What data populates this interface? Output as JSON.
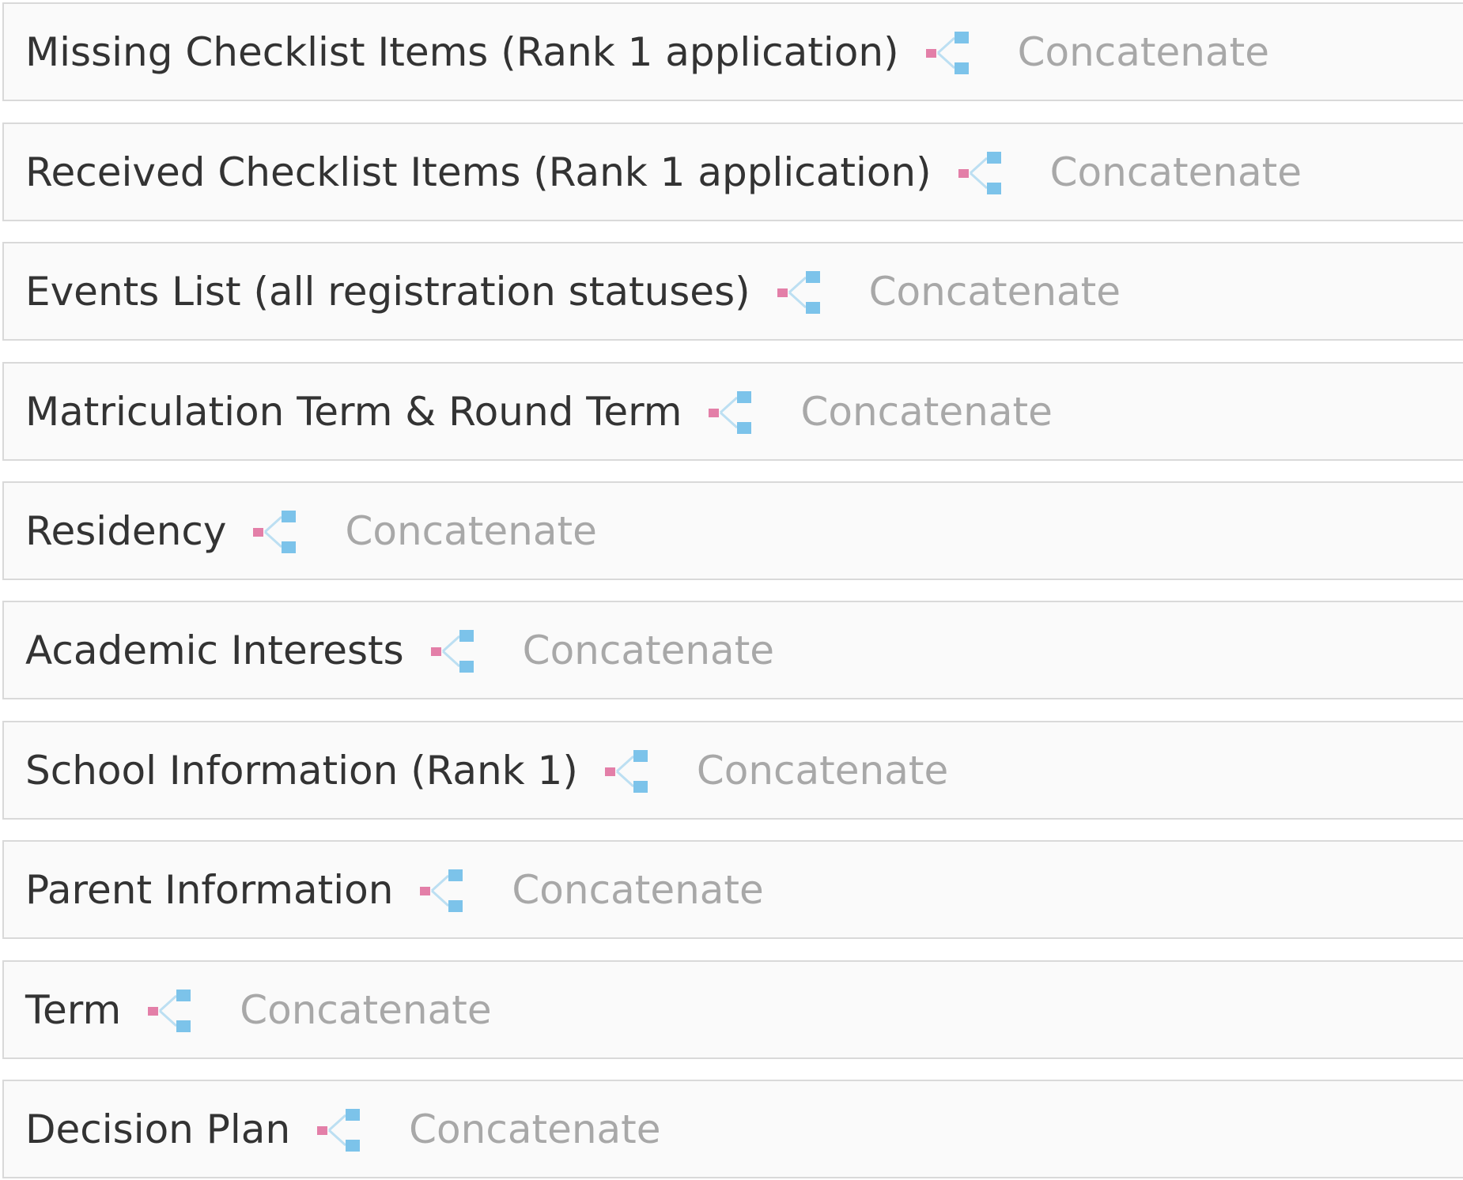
{
  "icon": {
    "name": "transform-icon",
    "source_color": "#e37fa8",
    "output_color": "#7cc3ea"
  },
  "rows": [
    {
      "field": "Missing Checklist Items (Rank 1 application)",
      "function": "Concatenate"
    },
    {
      "field": "Received Checklist Items (Rank 1 application)",
      "function": "Concatenate"
    },
    {
      "field": "Events List (all registration statuses)",
      "function": "Concatenate"
    },
    {
      "field": "Matriculation Term & Round Term",
      "function": "Concatenate"
    },
    {
      "field": "Residency",
      "function": "Concatenate"
    },
    {
      "field": "Academic Interests",
      "function": "Concatenate"
    },
    {
      "field": "School Information (Rank 1)",
      "function": "Concatenate"
    },
    {
      "field": "Parent Information",
      "function": "Concatenate"
    },
    {
      "field": "Term",
      "function": "Concatenate"
    },
    {
      "field": "Decision Plan",
      "function": "Concatenate"
    }
  ]
}
